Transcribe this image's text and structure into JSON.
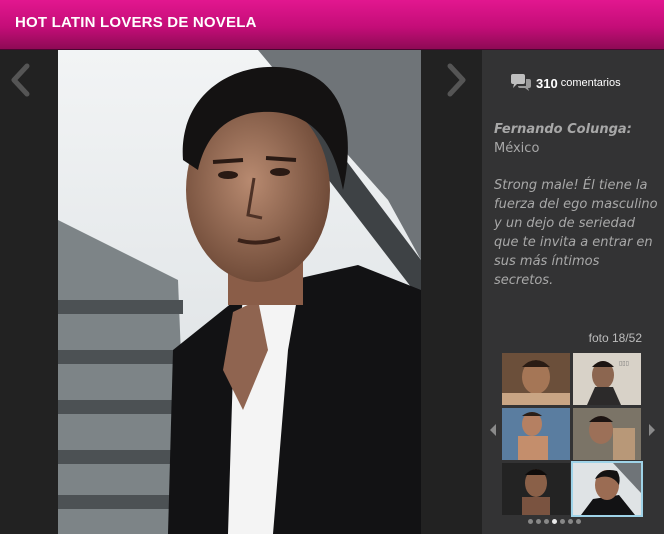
{
  "header": {
    "title": "HOT LATIN LOVERS DE NOVELA",
    "color": "#c40d78"
  },
  "gallery": {
    "prev_icon": "chevron-left-icon",
    "next_icon": "chevron-right-icon",
    "photo_subject": "Fernando Colunga portrait"
  },
  "sidebar": {
    "comments": {
      "icon": "comment-bubbles-icon",
      "count": "310",
      "label": "comentarios"
    },
    "caption": {
      "name": "Fernando Colunga:",
      "country": "México",
      "description": "Strong male! Él tiene la fuerza del ego masculino y un dejo de seriedad que te invita a entrar en sus más íntimos secretos."
    },
    "counter": "foto 18/52",
    "thumbnails_active_index": 5,
    "dots_total": 7,
    "dots_active_index": 3,
    "accent_active_thumb": "#9fd3e8"
  }
}
